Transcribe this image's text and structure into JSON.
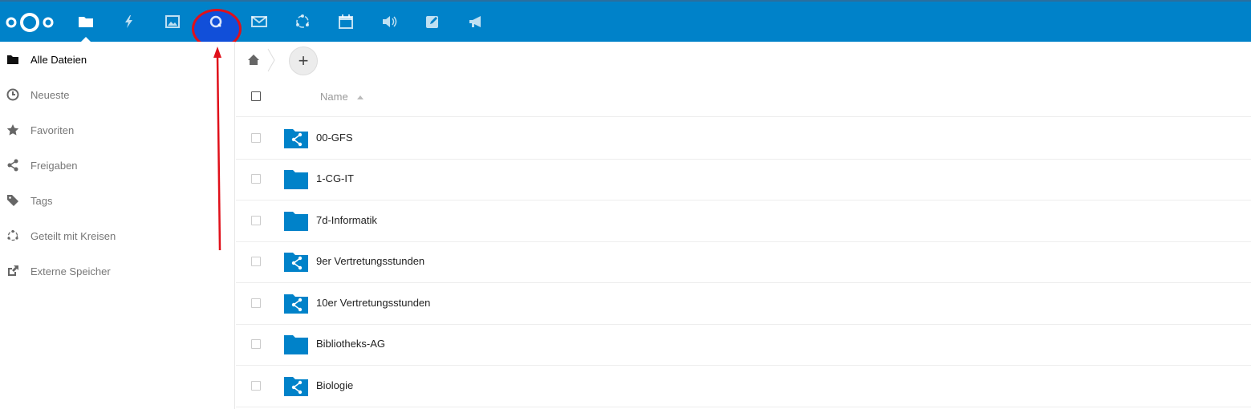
{
  "header": {
    "apps": [
      {
        "name": "files-app",
        "icon": "folder-icon",
        "active": true
      },
      {
        "name": "activity-app",
        "icon": "lightning-icon"
      },
      {
        "name": "gallery-app",
        "icon": "image-icon"
      },
      {
        "name": "search-app",
        "icon": "search-icon",
        "highlighted": true
      },
      {
        "name": "mail-app",
        "icon": "mail-icon"
      },
      {
        "name": "circles-app",
        "icon": "circles-icon"
      },
      {
        "name": "calendar-app",
        "icon": "calendar-icon"
      },
      {
        "name": "audio-app",
        "icon": "speaker-icon"
      },
      {
        "name": "notes-app",
        "icon": "edit-icon"
      },
      {
        "name": "announcements-app",
        "icon": "megaphone-icon"
      }
    ],
    "accent": "#0082c9"
  },
  "sidebar": {
    "items": [
      {
        "label": "Alle Dateien",
        "icon": "folder-icon",
        "active": true
      },
      {
        "label": "Neueste",
        "icon": "clock-icon"
      },
      {
        "label": "Favoriten",
        "icon": "star-icon"
      },
      {
        "label": "Freigaben",
        "icon": "share-icon"
      },
      {
        "label": "Tags",
        "icon": "tag-icon"
      },
      {
        "label": "Geteilt mit Kreisen",
        "icon": "circles-icon"
      },
      {
        "label": "Externe Speicher",
        "icon": "external-link-icon"
      }
    ]
  },
  "main": {
    "add_label": "+",
    "table": {
      "name_header": "Name",
      "rows": [
        {
          "name": "00-GFS",
          "shared": true
        },
        {
          "name": "1-CG-IT",
          "shared": false
        },
        {
          "name": "7d-Informatik",
          "shared": false
        },
        {
          "name": "9er Vertretungsstunden",
          "shared": true
        },
        {
          "name": "10er Vertretungsstunden",
          "shared": true
        },
        {
          "name": "Bibliotheks-AG",
          "shared": false
        },
        {
          "name": "Biologie",
          "shared": true
        }
      ]
    }
  },
  "annotation": {
    "color": "#e0101a"
  }
}
